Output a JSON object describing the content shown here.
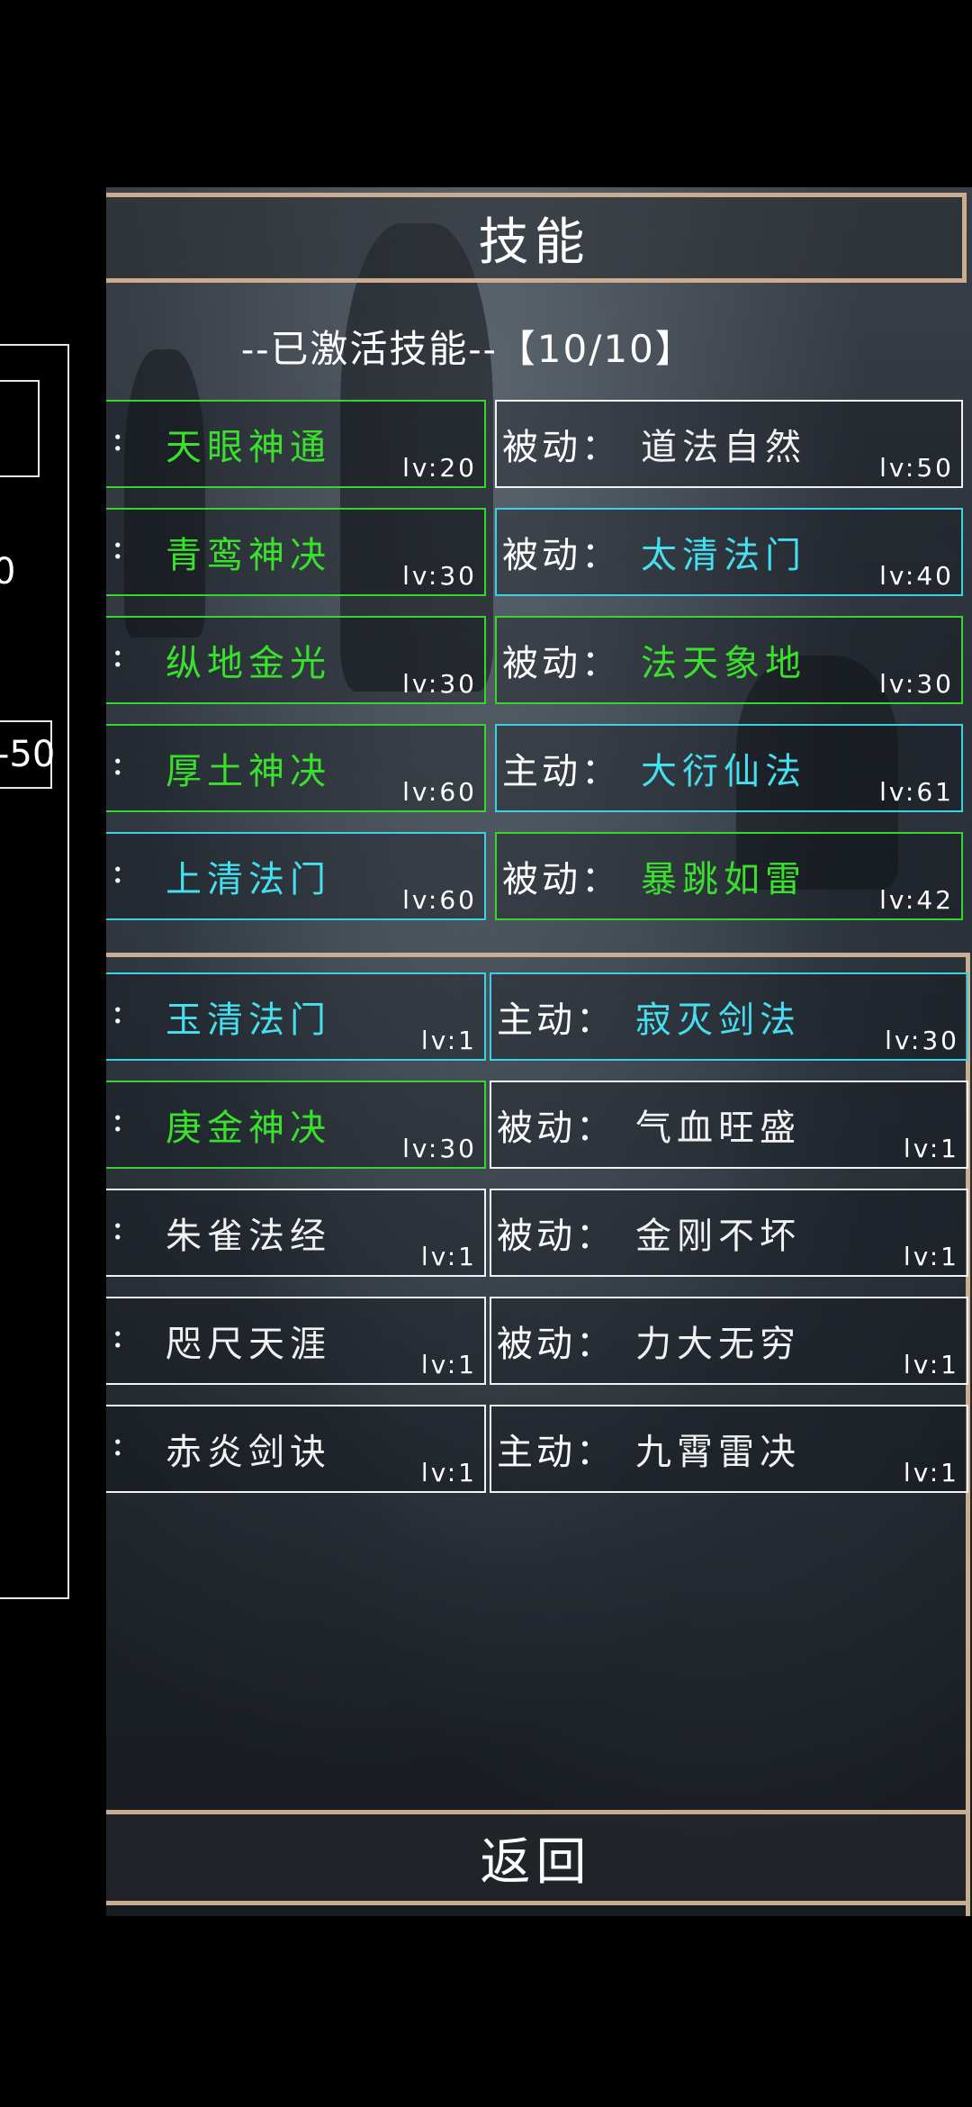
{
  "left_panel": {
    "value1": "0",
    "value2": "-50"
  },
  "title": "技能",
  "active_header": {
    "label": "--已激活技能--",
    "count": "【10/10】"
  },
  "active_skills": [
    {
      "type": "",
      "name": "天眼神通",
      "lv": "lv:20",
      "color": "green"
    },
    {
      "type": "被动：",
      "name": "道法自然",
      "lv": "lv:50",
      "color": "white"
    },
    {
      "type": "",
      "name": "青鸾神决",
      "lv": "lv:30",
      "color": "green"
    },
    {
      "type": "被动：",
      "name": "太清法门",
      "lv": "lv:40",
      "color": "cyan"
    },
    {
      "type": "",
      "name": "纵地金光",
      "lv": "lv:30",
      "color": "green"
    },
    {
      "type": "被动：",
      "name": "法天象地",
      "lv": "lv:30",
      "color": "green"
    },
    {
      "type": "",
      "name": "厚土神决",
      "lv": "lv:60",
      "color": "green"
    },
    {
      "type": "主动：",
      "name": "大衍仙法",
      "lv": "lv:61",
      "color": "cyan"
    },
    {
      "type": "",
      "name": "上清法门",
      "lv": "lv:60",
      "color": "cyan"
    },
    {
      "type": "被动：",
      "name": "暴跳如雷",
      "lv": "lv:42",
      "color": "green"
    }
  ],
  "other_skills": [
    {
      "type": "",
      "name": "玉清法门",
      "lv": "lv:1",
      "color": "cyan"
    },
    {
      "type": "主动：",
      "name": "寂灭剑法",
      "lv": "lv:30",
      "color": "cyan"
    },
    {
      "type": "",
      "name": "庚金神决",
      "lv": "lv:30",
      "color": "green"
    },
    {
      "type": "被动：",
      "name": "气血旺盛",
      "lv": "lv:1",
      "color": "white"
    },
    {
      "type": "",
      "name": "朱雀法经",
      "lv": "lv:1",
      "color": "white"
    },
    {
      "type": "被动：",
      "name": "金刚不坏",
      "lv": "lv:1",
      "color": "white"
    },
    {
      "type": "",
      "name": "咫尺天涯",
      "lv": "lv:1",
      "color": "white"
    },
    {
      "type": "被动：",
      "name": "力大无穷",
      "lv": "lv:1",
      "color": "white"
    },
    {
      "type": "",
      "name": "赤炎剑诀",
      "lv": "lv:1",
      "color": "white"
    },
    {
      "type": "主动：",
      "name": "九霄雷决",
      "lv": "lv:1",
      "color": "white"
    }
  ],
  "back_button": "返回",
  "colors": {
    "green": "#39e02c",
    "cyan": "#45dff0",
    "white": "#f2f2f2",
    "frame": "#c9ad8e"
  }
}
